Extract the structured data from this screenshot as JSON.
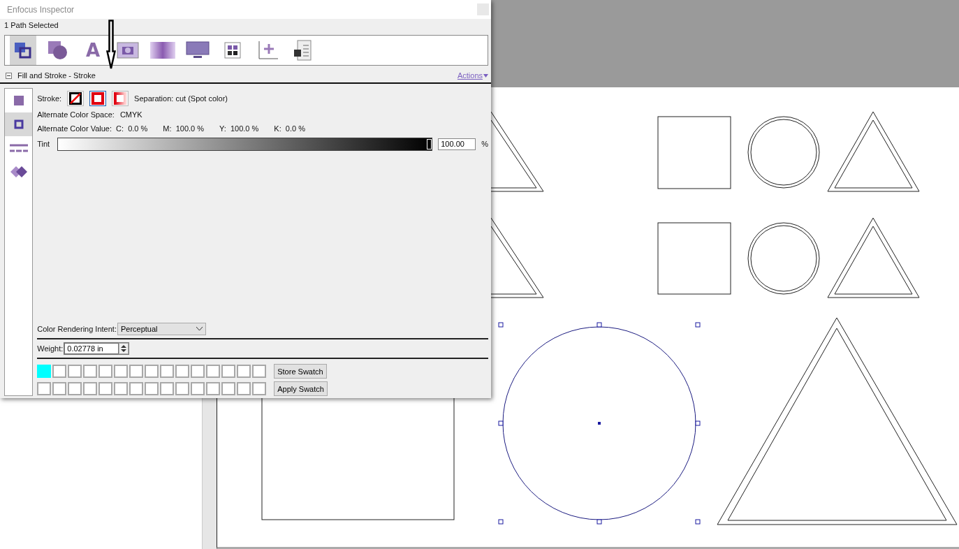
{
  "window": {
    "title": "Enfocus Inspector"
  },
  "status": "1 Path Selected",
  "tools": [
    {
      "kind": "objects",
      "selected": true
    },
    {
      "kind": "shape",
      "selected": false
    },
    {
      "kind": "text",
      "label": "A",
      "selected": false
    },
    {
      "kind": "image",
      "selected": false
    },
    {
      "kind": "transparency",
      "selected": false
    },
    {
      "kind": "display",
      "selected": false
    },
    {
      "kind": "grid",
      "selected": false
    },
    {
      "kind": "position",
      "selected": false
    },
    {
      "kind": "document",
      "selected": false
    }
  ],
  "section": {
    "title": "Fill and Stroke - Stroke",
    "actions": "Actions"
  },
  "side_tabs": [
    {
      "kind": "fill",
      "selected": false
    },
    {
      "kind": "stroke",
      "selected": true
    },
    {
      "kind": "dash",
      "selected": false
    },
    {
      "kind": "overprint",
      "selected": false
    }
  ],
  "stroke": {
    "label": "Stroke:",
    "options": [
      {
        "kind": "none",
        "selected": false
      },
      {
        "kind": "solid",
        "selected": true
      },
      {
        "kind": "gradient",
        "selected": false
      }
    ],
    "separation": "Separation: cut (Spot color)"
  },
  "alt_space": {
    "label": "Alternate Color Space:",
    "value": "CMYK"
  },
  "alt_value": {
    "label": "Alternate Color Value:",
    "channels": [
      {
        "name": "C:",
        "value": "0.0 %"
      },
      {
        "name": "M:",
        "value": "100.0 %"
      },
      {
        "name": "Y:",
        "value": "100.0 %"
      },
      {
        "name": "K:",
        "value": "0.0 %"
      }
    ]
  },
  "tint": {
    "label": "Tint",
    "level": 1.0,
    "value": "100.00",
    "unit": "%"
  },
  "intent": {
    "label": "Color Rendering Intent:",
    "value": "Perceptual"
  },
  "weight": {
    "label": "Weight:",
    "value": "0.02778 in"
  },
  "swatches": [
    [
      {
        "kind": "filled",
        "color": "#00ffff"
      },
      {
        "kind": "empty"
      },
      {
        "kind": "empty"
      },
      {
        "kind": "empty"
      },
      {
        "kind": "empty"
      },
      {
        "kind": "empty"
      },
      {
        "kind": "empty"
      },
      {
        "kind": "empty"
      },
      {
        "kind": "empty"
      },
      {
        "kind": "empty"
      },
      {
        "kind": "empty"
      },
      {
        "kind": "empty"
      },
      {
        "kind": "empty"
      },
      {
        "kind": "empty"
      },
      {
        "kind": "empty"
      }
    ],
    [
      {
        "kind": "empty"
      },
      {
        "kind": "empty"
      },
      {
        "kind": "empty"
      },
      {
        "kind": "empty"
      },
      {
        "kind": "empty"
      },
      {
        "kind": "empty"
      },
      {
        "kind": "empty"
      },
      {
        "kind": "empty"
      },
      {
        "kind": "empty"
      },
      {
        "kind": "empty"
      },
      {
        "kind": "empty"
      },
      {
        "kind": "empty"
      },
      {
        "kind": "empty"
      },
      {
        "kind": "empty"
      },
      {
        "kind": "empty"
      }
    ]
  ],
  "buttons": [
    "Store Swatch",
    "Apply Swatch"
  ]
}
